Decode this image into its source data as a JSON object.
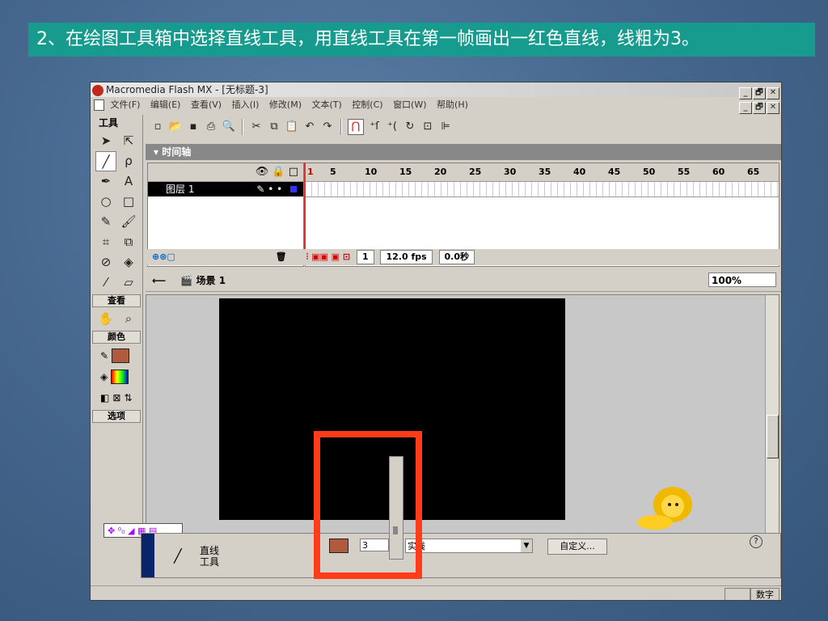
{
  "slide": {
    "title": "2、在绘图工具箱中选择直线工具，用直线工具在第一帧画出一红色直线，线粗为3。"
  },
  "window": {
    "title": "Macromedia Flash MX - [无标题-3]",
    "controls": [
      "_",
      "🗗",
      "✕"
    ]
  },
  "menu": [
    "文件(F)",
    "编辑(E)",
    "查看(V)",
    "插入(I)",
    "修改(M)",
    "文本(T)",
    "控制(C)",
    "窗口(W)",
    "帮助(H)"
  ],
  "toolbar": {
    "icons": [
      "new-icon",
      "open-icon",
      "save-icon",
      "print-icon",
      "preview-icon",
      "cut-icon",
      "copy-icon",
      "paste-icon",
      "undo-icon",
      "redo-icon",
      "magnet-icon",
      "smooth-icon",
      "straighten-icon",
      "rotate-icon",
      "scale-icon",
      "align-icon"
    ]
  },
  "tools": {
    "header": "工具",
    "view_label": "查看",
    "color_label": "颜色",
    "options_label": "选项"
  },
  "timeline": {
    "header": "▾ 时间轴",
    "ruler": [
      "1",
      "5",
      "10",
      "15",
      "20",
      "25",
      "30",
      "35",
      "40",
      "45",
      "50",
      "55",
      "60",
      "65"
    ],
    "layer_name": "图层 1",
    "frame": "1",
    "fps": "12.0 fps",
    "time": "0.0秒"
  },
  "scene": {
    "label": "场景 1",
    "zoom": "100%"
  },
  "properties": {
    "tool_line1": "直线",
    "tool_line2": "工具",
    "stroke_color": "#b05a40",
    "stroke_width": "3",
    "stroke_style": "实线",
    "custom_label": "自定义...",
    "help": "?"
  },
  "status": {
    "mode": "数字"
  },
  "colors": {
    "highlight": "#ff3c1a",
    "title_bg": "#169b8e"
  }
}
